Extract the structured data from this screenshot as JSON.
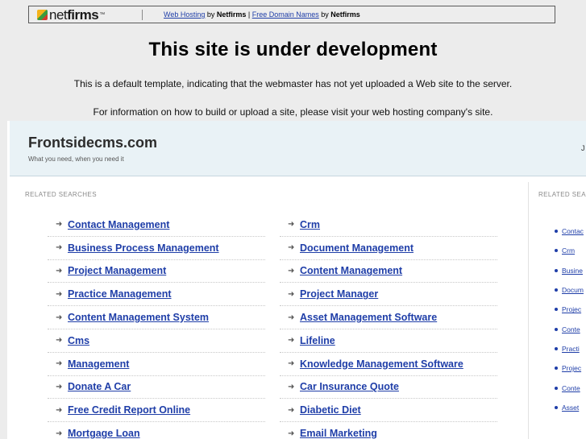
{
  "netfirms_bar": {
    "logo_text_net": "net",
    "logo_text_firms": "firms",
    "logo_tm": "™",
    "link_web_hosting": "Web Hosting",
    "by1": " by ",
    "brand1": "Netfirms",
    "pipe": " | ",
    "link_free_domains": "Free Domain Names",
    "by2": " by ",
    "brand2": "Netfirms"
  },
  "notice": {
    "title": "This site is under development",
    "line1": "This is a default template, indicating that the webmaster has not yet uploaded a Web site to the server.",
    "line2": "For information on how to build or upload a site, please visit your web hosting company's site."
  },
  "site": {
    "title": "Frontsidecms.com",
    "tagline": "What you need, when you need it",
    "right_char": "J",
    "related_label": "RELATED SEARCHES",
    "related_label_right": "RELATED SEA",
    "left_col": [
      "Contact Management",
      "Business Process Management",
      "Project Management",
      "Practice Management",
      "Content Management System",
      "Cms",
      "Management",
      "Donate A Car",
      "Free Credit Report Online",
      "Mortgage Loan"
    ],
    "right_col": [
      "Crm",
      "Document Management",
      "Content Management",
      "Project Manager",
      "Asset Management Software",
      "Lifeline",
      "Knowledge Management Software",
      "Car Insurance Quote",
      "Diabetic Diet",
      "Email Marketing"
    ],
    "side_col": [
      "Contac",
      "Crm",
      "Busine",
      "Docum",
      "Projec",
      "Conte",
      "Practi",
      "Projec",
      "Conte",
      "Asset"
    ]
  }
}
